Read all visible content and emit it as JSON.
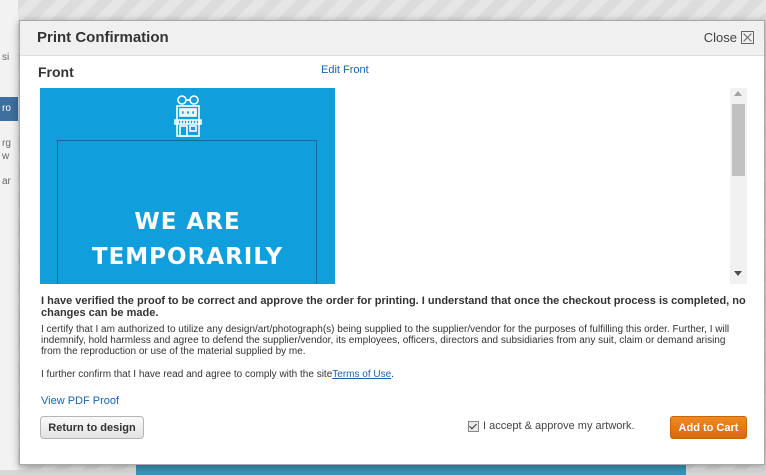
{
  "background": {
    "left_strip": [
      "si",
      "ro",
      "rg",
      "w",
      "ar"
    ]
  },
  "modal": {
    "title": "Print Confirmation",
    "close_label": "Close",
    "front_label": "Front",
    "edit_front_label": "Edit Front",
    "preview": {
      "line1": "WE ARE",
      "line2": "TEMPORARILY",
      "background_color": "#0f9fdc",
      "icon": "storefront-icon"
    },
    "legal": {
      "verify_text": "I have verified the proof to be correct and approve the order for printing. I understand that once the checkout process is completed, no changes can be made.",
      "certify_text": "I certify that I am authorized to utilize any design/art/photograph(s) being supplied to the supplier/vendor for the purposes of fulfilling this order. Further, I will indemnify, hold harmless and agree to defend the supplier/vendor, its employees, officers, directors and subsidiaries from any suit, claim or demand arising from the reproduction or use of the material supplied by me.",
      "confirm_prefix": "I further confirm that I have read and agree to comply with the site",
      "terms_link": "Terms of Use",
      "confirm_suffix": "."
    },
    "view_pdf_label": "View PDF Proof",
    "return_button": "Return to design",
    "accept_label": "I accept & approve my artwork.",
    "accept_checked": true,
    "add_to_cart_button": "Add to Cart",
    "accent_color": "#e67e16",
    "link_color": "#1a62b3"
  }
}
